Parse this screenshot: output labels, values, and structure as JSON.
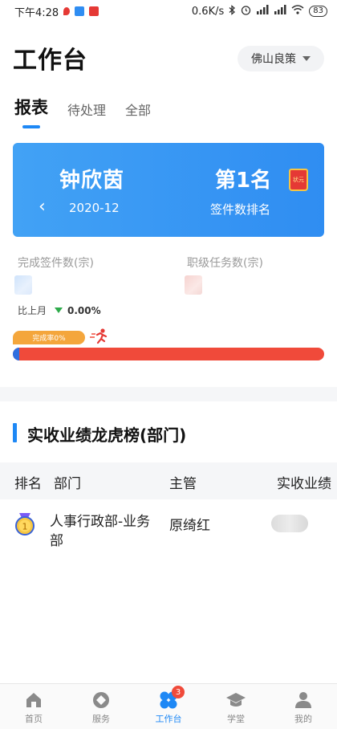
{
  "status_bar": {
    "time": "下午4:28",
    "network_speed": "0.6K/s",
    "battery": "83"
  },
  "header": {
    "title": "工作台",
    "company": "佛山良策"
  },
  "tabs": [
    {
      "label": "报表",
      "active": true
    },
    {
      "label": "待处理",
      "active": false
    },
    {
      "label": "全部",
      "active": false
    }
  ],
  "rank_card": {
    "name": "钟欣茵",
    "month": "2020-12",
    "rank": "第1名",
    "rank_label": "签件数排名",
    "back_icon": "chevron-left-icon",
    "badge_icon": "award-flag-icon",
    "badge_text": "状元",
    "gradient_start": "#42a2f5",
    "gradient_end": "#2f8df2"
  },
  "stats": {
    "completed_label": "完成签件数(宗)",
    "rank_tasks_label": "职级任务数(宗)",
    "compare_label": "比上月",
    "compare_value": "0.00%",
    "trend": "down"
  },
  "progress": {
    "label": "完成率0%",
    "percent": 0.02,
    "fill_color": "#2f6fe0",
    "track_color": "#f04a3a"
  },
  "leaderboard": {
    "title": "实收业绩龙虎榜(部门)",
    "columns": [
      "排名",
      "部门",
      "主管",
      "实收业绩"
    ],
    "rows": [
      {
        "rank": "1",
        "department": "人事行政部-业务部",
        "manager": "原绮红"
      }
    ]
  },
  "bottom_nav": [
    {
      "label": "首页",
      "icon": "home-icon",
      "active": false
    },
    {
      "label": "服务",
      "icon": "service-icon",
      "active": false
    },
    {
      "label": "工作台",
      "icon": "workbench-icon",
      "active": true,
      "badge": "3"
    },
    {
      "label": "学堂",
      "icon": "graduation-cap-icon",
      "active": false
    },
    {
      "label": "我的",
      "icon": "user-icon",
      "active": false
    }
  ],
  "colors": {
    "accent": "#1e88f5",
    "danger": "#f04a3a",
    "orange": "#f4a63c",
    "trend_down": "#2eab4b"
  }
}
